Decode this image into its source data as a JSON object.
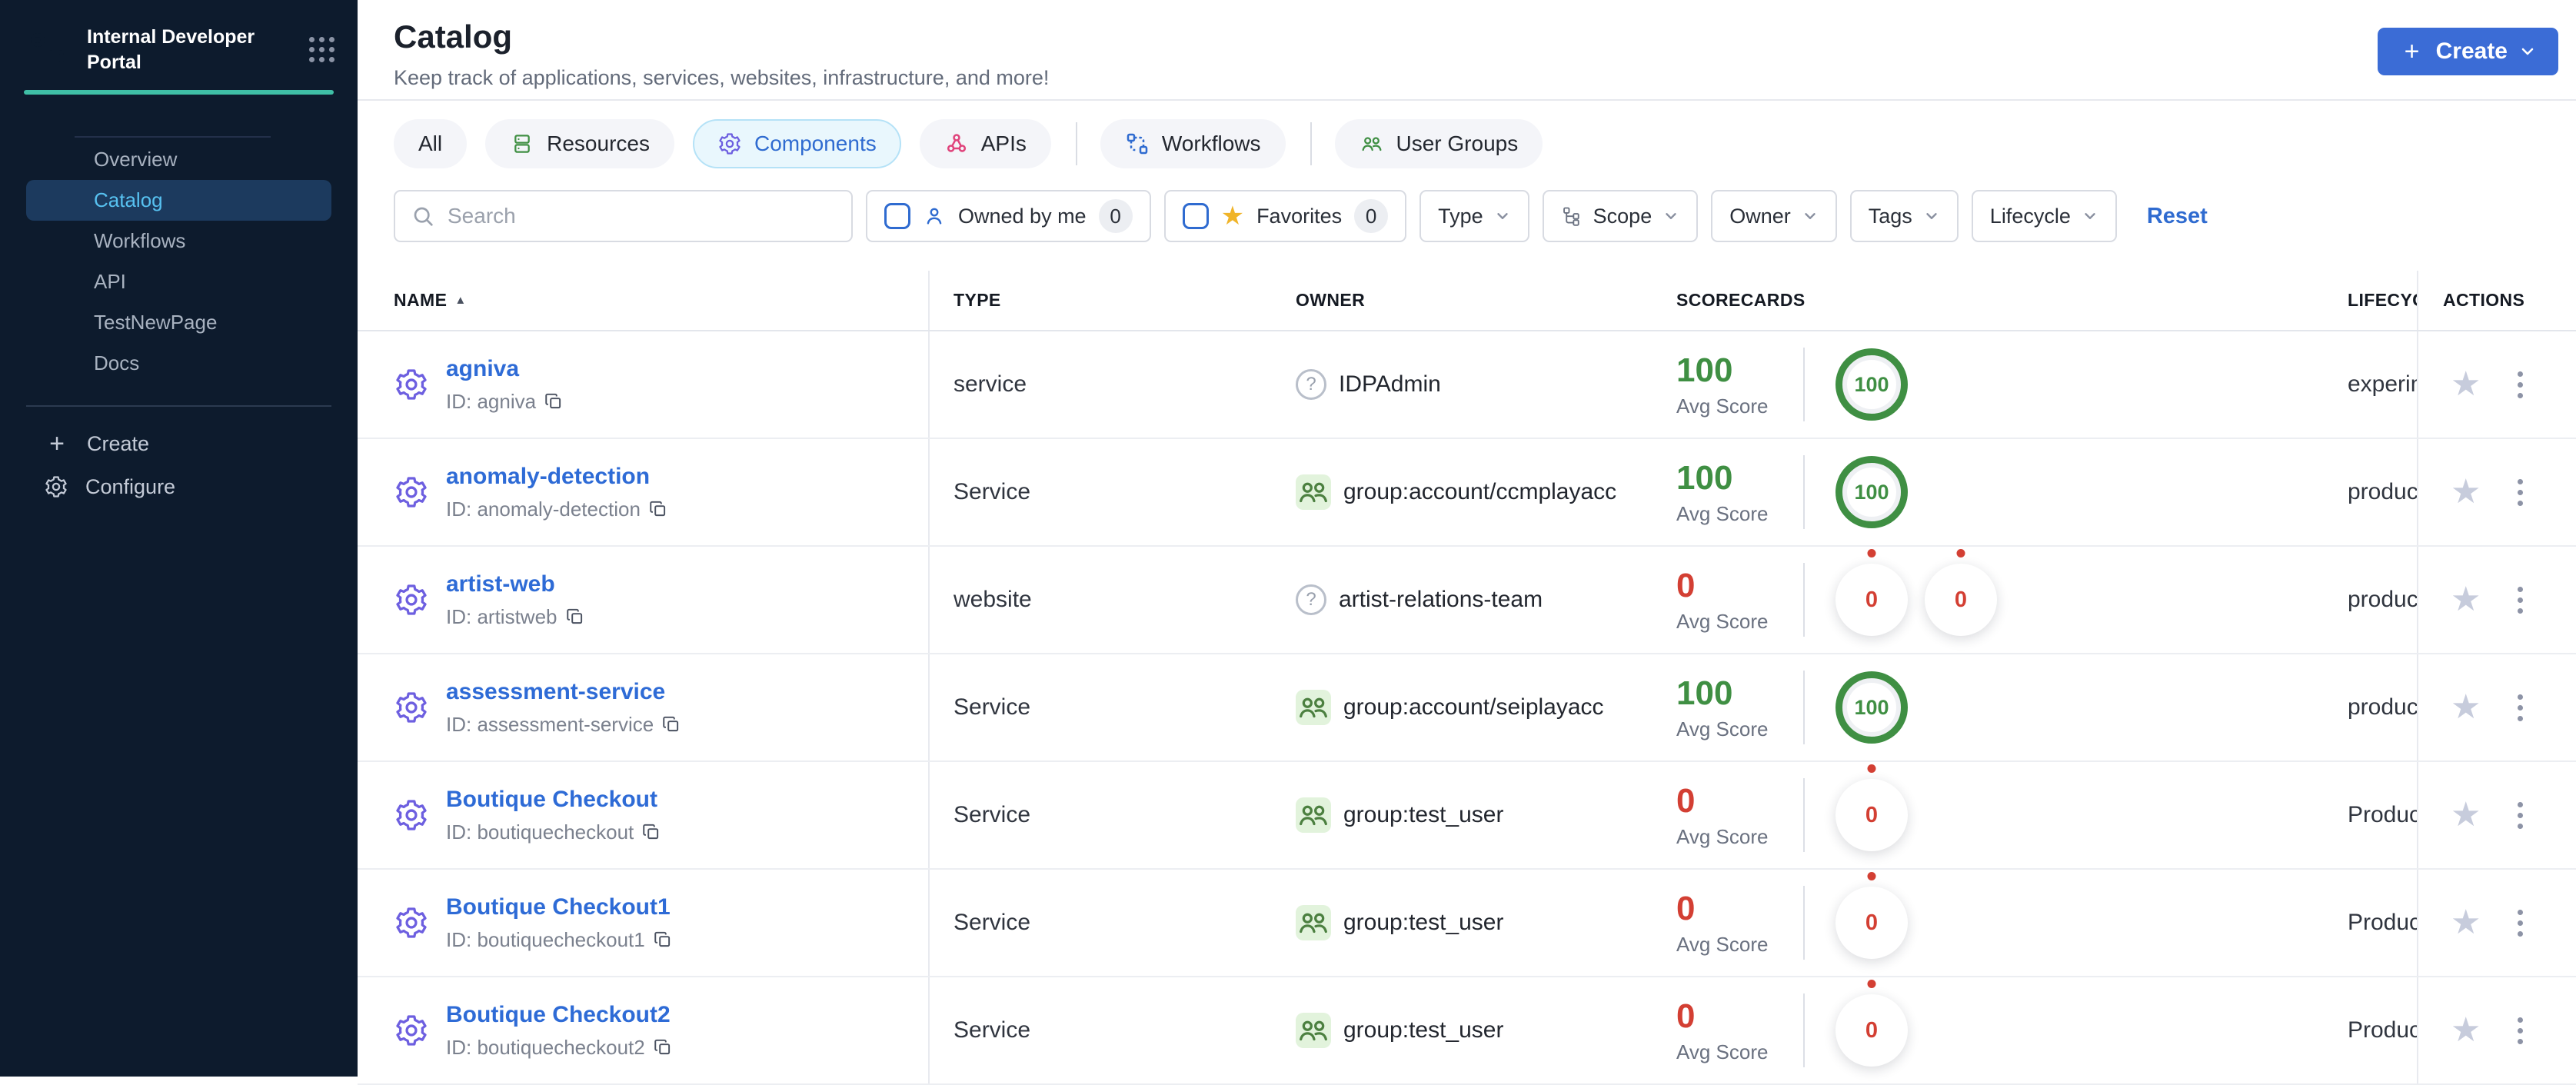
{
  "colors": {
    "sidebar_bg": "#0d1b2d",
    "accent_teal": "#3fbfa6",
    "primary_button_blue": "#3b6cd6",
    "link_blue": "#2e6bd6",
    "active_nav_text": "#57c1f0",
    "active_tab_bg": "#e9f7fd",
    "score_green": "#3f8f43",
    "score_red": "#d33f33",
    "gear_purple": "#6d5fe0"
  },
  "sidebar": {
    "title": "Internal Developer Portal",
    "items": [
      {
        "label": "Overview"
      },
      {
        "label": "Catalog",
        "active": true
      },
      {
        "label": "Workflows"
      },
      {
        "label": "API"
      },
      {
        "label": "TestNewPage"
      },
      {
        "label": "Docs"
      }
    ],
    "create_label": "Create",
    "configure_label": "Configure"
  },
  "header": {
    "title": "Catalog",
    "subtitle": "Keep track of applications, services, websites, infrastructure, and more!",
    "create_button_label": "Create"
  },
  "tabs": [
    {
      "label": "All"
    },
    {
      "label": "Resources",
      "icon": "resources-icon"
    },
    {
      "label": "Components",
      "icon": "components-gear-icon",
      "active": true
    },
    {
      "label": "APIs",
      "icon": "apis-icon"
    },
    {
      "label": "Workflows",
      "icon": "workflows-icon"
    },
    {
      "label": "User Groups",
      "icon": "user-groups-icon"
    }
  ],
  "filters": {
    "search_placeholder": "Search",
    "owned_by_me": {
      "label": "Owned by me",
      "count": "0"
    },
    "favorites": {
      "label": "Favorites",
      "count": "0"
    },
    "dropdowns": [
      {
        "label": "Type"
      },
      {
        "label": "Scope",
        "icon": "scope-hierarchy-icon"
      },
      {
        "label": "Owner"
      },
      {
        "label": "Tags"
      },
      {
        "label": "Lifecycle"
      }
    ],
    "reset_label": "Reset"
  },
  "table": {
    "columns": {
      "name": "NAME",
      "type": "TYPE",
      "owner": "OWNER",
      "scorecards": "SCORECARDS",
      "lifecycle": "LIFECYCLE",
      "actions": "ACTIONS"
    },
    "sort": {
      "column": "NAME",
      "direction": "asc"
    },
    "labels": {
      "avg_score": "Avg Score"
    },
    "rows": [
      {
        "name": "agniva",
        "id_label": "ID: agniva",
        "type": "service",
        "owner": "IDPAdmin",
        "owner_icon": "unknown-owner-icon",
        "avg_score": "100",
        "score_state": "good",
        "scorecards": [
          "100"
        ],
        "lifecycle": "experimental"
      },
      {
        "name": "anomaly-detection",
        "id_label": "ID: anomaly-detection",
        "type": "Service",
        "owner": "group:account/ccmplayacc",
        "owner_icon": "group-icon",
        "avg_score": "100",
        "score_state": "good",
        "scorecards": [
          "100"
        ],
        "lifecycle": "production"
      },
      {
        "name": "artist-web",
        "id_label": "ID: artistweb",
        "type": "website",
        "owner": "artist-relations-team",
        "owner_icon": "unknown-owner-icon",
        "avg_score": "0",
        "score_state": "bad",
        "scorecards": [
          "0",
          "0"
        ],
        "lifecycle": "production"
      },
      {
        "name": "assessment-service",
        "id_label": "ID: assessment-service",
        "type": "Service",
        "owner": "group:account/seiplayacc",
        "owner_icon": "group-icon",
        "avg_score": "100",
        "score_state": "good",
        "scorecards": [
          "100"
        ],
        "lifecycle": "production"
      },
      {
        "name": "Boutique Checkout",
        "id_label": "ID: boutiquecheckout",
        "type": "Service",
        "owner": "group:test_user",
        "owner_icon": "group-icon",
        "avg_score": "0",
        "score_state": "bad",
        "scorecards": [
          "0"
        ],
        "lifecycle": "Production"
      },
      {
        "name": "Boutique Checkout1",
        "id_label": "ID: boutiquecheckout1",
        "type": "Service",
        "owner": "group:test_user",
        "owner_icon": "group-icon",
        "avg_score": "0",
        "score_state": "bad",
        "scorecards": [
          "0"
        ],
        "lifecycle": "Production"
      },
      {
        "name": "Boutique Checkout2",
        "id_label": "ID: boutiquecheckout2",
        "type": "Service",
        "owner": "group:test_user",
        "owner_icon": "group-icon",
        "avg_score": "0",
        "score_state": "bad",
        "scorecards": [
          "0"
        ],
        "lifecycle": "Production"
      }
    ]
  }
}
